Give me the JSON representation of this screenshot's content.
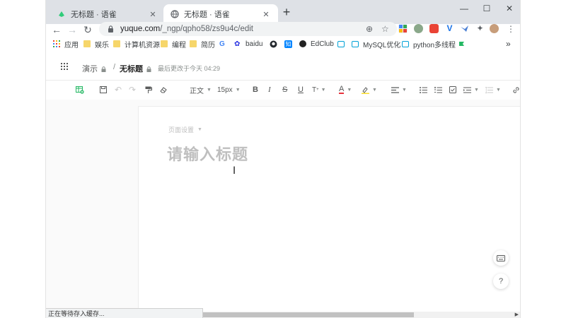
{
  "tabs": [
    {
      "title": "无标题 · 语雀",
      "active": false
    },
    {
      "title": "无标题 · 语雀",
      "active": true
    }
  ],
  "window_controls": {
    "minimize": "—",
    "maximize": "☐",
    "close": "✕"
  },
  "nav": {
    "back": "←",
    "forward": "→",
    "reload": "↻"
  },
  "address": {
    "host": "yuque.com",
    "path": "/_ngp/qpho58/zs9u4c/edit"
  },
  "bookmarks": [
    {
      "label": "应用",
      "icon": "apps-grid-icon"
    },
    {
      "label": "娱乐",
      "icon": "folder-icon"
    },
    {
      "label": "计算机资源",
      "icon": "folder-icon"
    },
    {
      "label": "编程",
      "icon": "folder-icon"
    },
    {
      "label": "简历",
      "icon": "folder-icon"
    },
    {
      "label": "",
      "icon": "google-icon"
    },
    {
      "label": "baidu",
      "icon": "baidu-icon"
    },
    {
      "label": "",
      "icon": "github-icon"
    },
    {
      "label": "",
      "icon": "zhihu-icon"
    },
    {
      "label": "EdClub",
      "icon": "edclub-icon"
    },
    {
      "label": "",
      "icon": "bilibili-icon"
    },
    {
      "label": "MySQL优化",
      "icon": "bilibili-icon"
    },
    {
      "label": "python多线程",
      "icon": "bilibili-icon"
    }
  ],
  "bookmarks_overflow": "»",
  "header": {
    "space": "演示",
    "separator": "/",
    "doc": "无标题",
    "saved": "最后更改于今天 04:29"
  },
  "toolbar": {
    "paragraph_style": "正文",
    "font_size": "15px"
  },
  "editor": {
    "page_settings": "页面设置",
    "title_placeholder": "请输入标题"
  },
  "status_text": "正在等待存入缓存...",
  "colors": {
    "accent": "#25b864",
    "placeholder": "#bfbfbf",
    "folder": "#f6d66a"
  }
}
